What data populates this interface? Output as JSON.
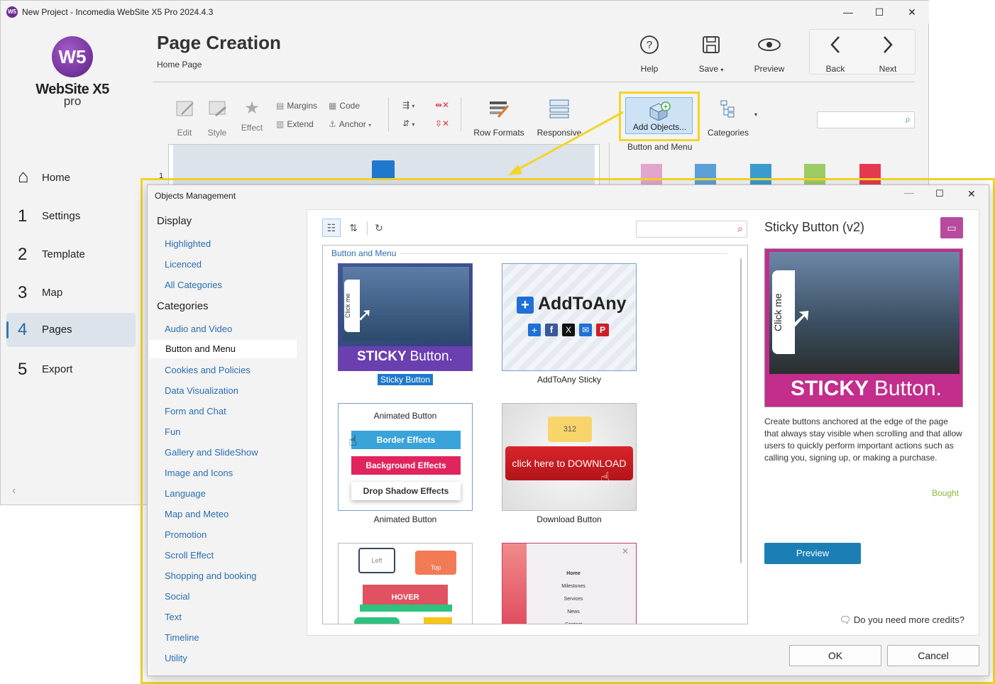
{
  "window": {
    "title": "New Project - Incomedia WebSite X5 Pro 2024.4.3",
    "minimize": "—",
    "maximize": "☐",
    "close": "✕"
  },
  "logo": {
    "mark": "W5",
    "name": "WebSite X5",
    "edition": "pro"
  },
  "sidebar": {
    "items": [
      {
        "num": "⌂",
        "label": "Home"
      },
      {
        "num": "1",
        "label": "Settings"
      },
      {
        "num": "2",
        "label": "Template"
      },
      {
        "num": "3",
        "label": "Map"
      },
      {
        "num": "4",
        "label": "Pages"
      },
      {
        "num": "5",
        "label": "Export"
      }
    ],
    "collapse": "‹"
  },
  "header": {
    "title": "Page Creation",
    "subtitle": "Home Page"
  },
  "toolbar_top": {
    "help": "Help",
    "save": "Save",
    "preview": "Preview",
    "back": "Back",
    "next": "Next"
  },
  "toolbar": {
    "edit": "Edit",
    "style": "Style",
    "effect": "Effect",
    "margins": "Margins",
    "extend": "Extend",
    "code": "Code",
    "anchor": "Anchor",
    "row_formats": "Row Formats",
    "responsive": "Responsive",
    "add_objects": "Add Objects...",
    "categories": "Categories"
  },
  "side_group": "Button and Menu",
  "row_number": "1",
  "dialog": {
    "title": "Objects Management",
    "display_header": "Display",
    "display_items": [
      "Highlighted",
      "Licenced",
      "All Categories"
    ],
    "categories_header": "Categories",
    "categories": [
      "Audio and Video",
      "Button and Menu",
      "Cookies and Policies",
      "Data Visualization",
      "Form and Chat",
      "Fun",
      "Gallery and SlideShow",
      "Image and Icons",
      "Language",
      "Map and Meteo",
      "Promotion",
      "Scroll Effect",
      "Shopping and booking",
      "Social",
      "Text",
      "Timeline",
      "Utility"
    ],
    "selected_category": "Button and Menu",
    "group_label": "Button and Menu",
    "objects": [
      {
        "name": "Sticky Button",
        "selected": true
      },
      {
        "name": "AddToAny Sticky"
      },
      {
        "name": "Animated Button"
      },
      {
        "name": "Download Button"
      }
    ],
    "tiles": {
      "sticky": {
        "label": "STICKY",
        "label2": "Button.",
        "click": "Click me"
      },
      "addtoany": {
        "text": "AddToAny"
      },
      "animated": {
        "title": "Animated Button",
        "b1": "Border Effects",
        "b2": "Background Effects",
        "b3": "Drop Shadow Effects"
      },
      "download": {
        "count": "312",
        "text": "click here to DOWNLOAD"
      },
      "tile5": {
        "left": "Left",
        "top": "Top",
        "hover": "HOVER"
      },
      "tile6": {
        "items": [
          "Home",
          "Milestones",
          "Services",
          "News",
          "Contact"
        ]
      }
    },
    "detail": {
      "title": "Sticky Button (v2)",
      "image_label": "STICKY",
      "image_label2": "Button.",
      "image_click": "Click me",
      "description": "Create buttons anchored at the edge of the page that always stay visible when scrolling and that allow users to quickly perform important actions such as calling you, signing up, or making a purchase.",
      "status": "Bought",
      "preview_button": "Preview",
      "credits": "Do you need more credits?"
    },
    "ok": "OK",
    "cancel": "Cancel"
  },
  "colors": {
    "highlight": "#f2d529",
    "accent": "#1f78cc",
    "brand": "#6a2f8f",
    "status_green": "#8bb73a"
  }
}
